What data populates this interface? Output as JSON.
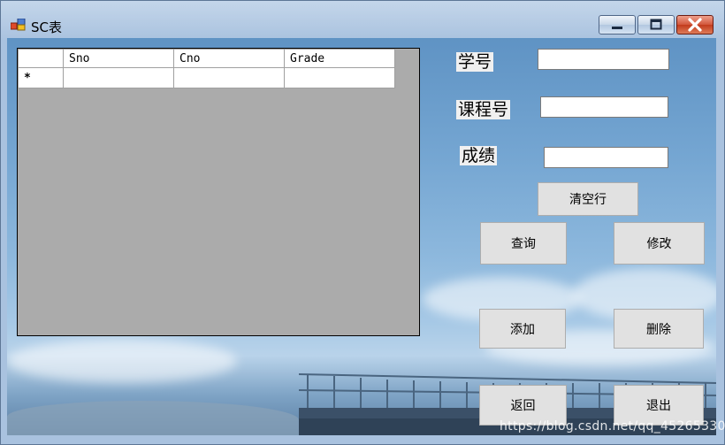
{
  "window": {
    "title": "SC表"
  },
  "grid": {
    "columns": [
      "Sno",
      "Cno",
      "Grade"
    ],
    "new_row_marker": "*"
  },
  "form": {
    "sno_label": "学号",
    "cno_label": "课程号",
    "grade_label": "成绩",
    "sno_value": "",
    "cno_value": "",
    "grade_value": ""
  },
  "buttons": {
    "clear": "清空行",
    "query": "查询",
    "modify": "修改",
    "add": "添加",
    "delete": "删除",
    "back": "返回",
    "exit": "退出"
  },
  "watermark": "https://blog.csdn.net/qq_45265330"
}
